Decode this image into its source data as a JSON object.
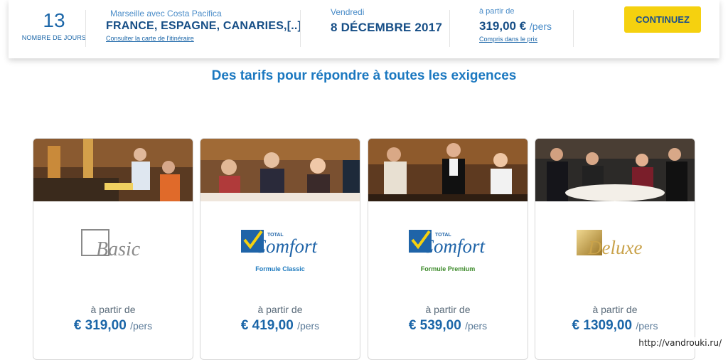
{
  "header": {
    "days_count": "13",
    "days_label": "NOMBRE DE JOURS",
    "departure": "Marseille avec Costa Pacifica",
    "route": "FRANCE, ESPAGNE, CANARIES,[..]",
    "itinerary_link": "Consulter la carte de l'itinéraire",
    "weekday": "Vendredi",
    "date": "8 DÉCEMBRE 2017",
    "from_label": "à partir de",
    "price": "319,00 €",
    "per_person": "/pers",
    "included_link": "Compris dans le prix",
    "cta_label": "CONTINUEZ"
  },
  "headline": "Des tarifs pour répondre à toutes les exigences",
  "cards": [
    {
      "brand_small": "",
      "brand": "Basic",
      "formula": "",
      "from_label": "à partir de",
      "price": "€ 319,00",
      "per_person": "/pers"
    },
    {
      "brand_small": "TOTAL",
      "brand": "Comfort",
      "formula": "Formule Classic",
      "from_label": "à partir de",
      "price": "€ 419,00",
      "per_person": "/pers"
    },
    {
      "brand_small": "TOTAL",
      "brand": "Comfort",
      "formula": "Formule Premium",
      "from_label": "à partir de",
      "price": "€ 539,00",
      "per_person": "/pers"
    },
    {
      "brand_small": "",
      "brand": "Deluxe",
      "formula": "",
      "from_label": "à partir de",
      "price": "€ 1309,00",
      "per_person": "/pers"
    }
  ],
  "colors": {
    "primary_blue": "#1b66a8",
    "cta_yellow": "#f5d10f",
    "classic_blue": "#1f7bbf",
    "premium_green": "#3c8a2a",
    "deluxe_gold": "#c9a24a"
  },
  "watermark": "http://vandrouki.ru/"
}
